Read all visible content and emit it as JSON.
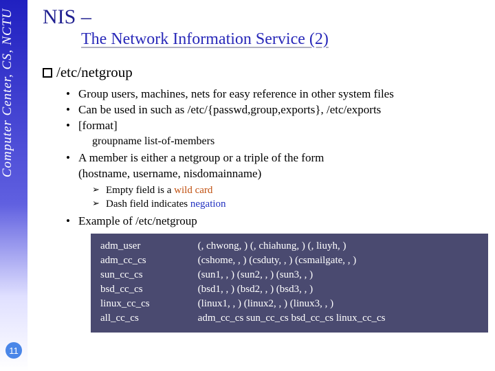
{
  "sidebar": {
    "vertical_label": "Computer Center, CS, NCTU",
    "slide_number": "11"
  },
  "title": {
    "main": "NIS",
    "dash": " –",
    "subtitle": "The Network Information Service (2)"
  },
  "section": {
    "heading": "/etc/netgroup"
  },
  "bullets": {
    "b1": "Group users, machines, nets for easy reference in other system files",
    "b2": "Can be used in such as /etc/{passwd,group,exports}, /etc/exports",
    "b3": "[format]",
    "b3_code": "groupname list-of-members",
    "b4a": "A member is either a netgroup or a triple of the form",
    "b4b": "(hostname, username, nisdomainname)",
    "b4_arrow1_pre": "Empty field is a ",
    "b4_arrow1_em": "wild card",
    "b4_arrow2_pre": "Dash field indicates ",
    "b4_arrow2_em": "negation",
    "b5": "Example of /etc/netgroup"
  },
  "example": {
    "col1": "adm_user\nadm_cc_cs\nsun_cc_cs\nbsd_cc_cs\nlinux_cc_cs\nall_cc_cs",
    "col2": "(, chwong, ) (, chiahung, ) (, liuyh, )\n(cshome, , ) (csduty, , ) (csmailgate, , )\n(sun1, , ) (sun2, , ) (sun3, , )\n(bsd1, , ) (bsd2, , ) (bsd3, , )\n(linux1, , ) (linux2, , ) (linux3, , )\nadm_cc_cs sun_cc_cs bsd_cc_cs linux_cc_cs"
  }
}
